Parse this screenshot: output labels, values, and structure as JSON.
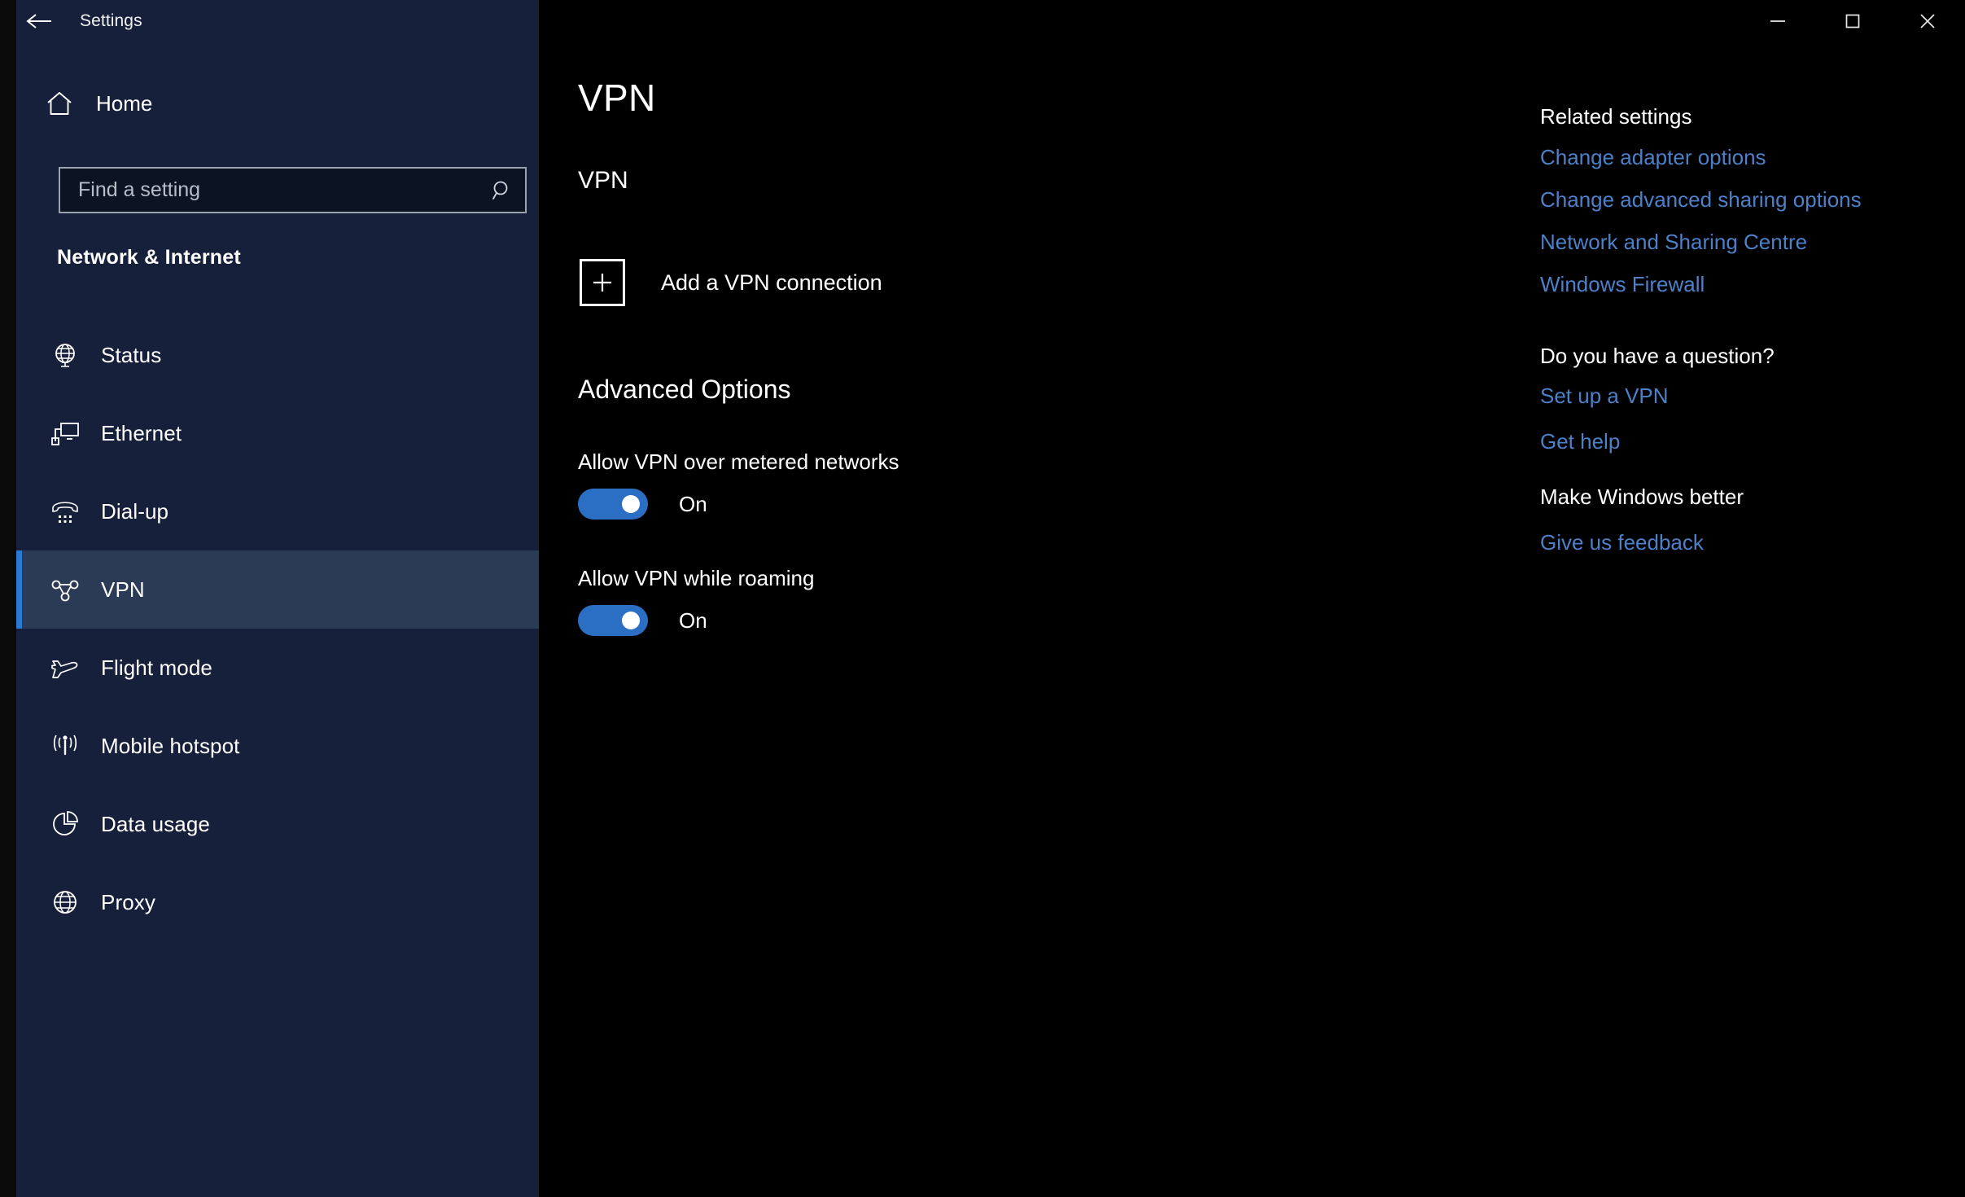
{
  "window": {
    "title": "Settings",
    "back_icon": "back-arrow-icon",
    "controls": {
      "minimize": "minimize-icon",
      "maximize": "maximize-icon",
      "close": "close-icon"
    }
  },
  "sidebar": {
    "home": {
      "label": "Home",
      "icon": "home-icon"
    },
    "search": {
      "placeholder": "Find a setting",
      "value": "",
      "icon": "search-icon"
    },
    "category": "Network & Internet",
    "items": [
      {
        "label": "Status",
        "icon": "globe-icon",
        "selected": false
      },
      {
        "label": "Ethernet",
        "icon": "monitor-network-icon",
        "selected": false
      },
      {
        "label": "Dial-up",
        "icon": "telephone-icon",
        "selected": false
      },
      {
        "label": "VPN",
        "icon": "vpn-icon",
        "selected": true
      },
      {
        "label": "Flight mode",
        "icon": "airplane-icon",
        "selected": false
      },
      {
        "label": "Mobile hotspot",
        "icon": "hotspot-icon",
        "selected": false
      },
      {
        "label": "Data usage",
        "icon": "pie-chart-icon",
        "selected": false
      },
      {
        "label": "Proxy",
        "icon": "globe-icon",
        "selected": false
      }
    ]
  },
  "main": {
    "page_title": "VPN",
    "vpn_section_heading": "VPN",
    "add_vpn_label": "Add a VPN connection",
    "add_vpn_icon": "plus-icon",
    "advanced_heading": "Advanced Options",
    "settings": [
      {
        "label": "Allow VPN over metered networks",
        "state": "On",
        "checked": true
      },
      {
        "label": "Allow VPN while roaming",
        "state": "On",
        "checked": true
      }
    ]
  },
  "right_panel": {
    "related_heading": "Related settings",
    "related_links": [
      "Change adapter options",
      "Change advanced sharing options",
      "Network and Sharing Centre",
      "Windows Firewall"
    ],
    "question_heading": "Do you have a question?",
    "question_links": [
      "Set up a VPN",
      "Get help"
    ],
    "feedback_heading": "Make Windows better",
    "feedback_links": [
      "Give us feedback"
    ]
  },
  "colors": {
    "accent": "#2a7ad4",
    "toggle_on": "#2b6fc4",
    "link": "#4e80c8",
    "sidebar_bg": "#17203a",
    "selected_bg": "#2b3a55",
    "main_bg": "#000000"
  }
}
